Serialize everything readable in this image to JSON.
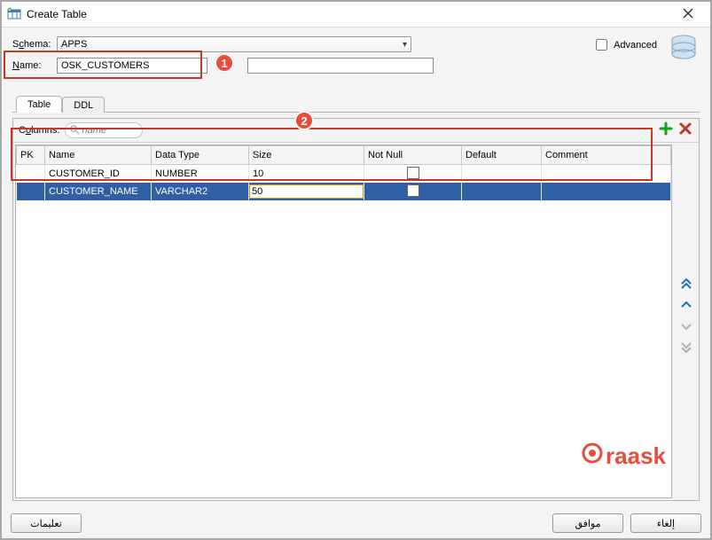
{
  "window": {
    "title": "Create Table"
  },
  "form": {
    "schema_label_pre": "S",
    "schema_label_u": "c",
    "schema_label_post": "hema:",
    "schema_value": "APPS",
    "name_label_pre": "",
    "name_label_u": "N",
    "name_label_post": "ame:",
    "name_value": "OSK_CUSTOMERS",
    "advanced_label": "Advanced"
  },
  "tabs": {
    "table": "Table",
    "ddl": "DDL"
  },
  "toolbar": {
    "columns_label_pre": "C",
    "columns_label_u": "o",
    "columns_label_post": "lumns:",
    "search_placeholder": "name"
  },
  "grid": {
    "headers": {
      "pk": "PK",
      "name": "Name",
      "data_type": "Data Type",
      "size": "Size",
      "not_null": "Not Null",
      "default": "Default",
      "comment": "Comment"
    },
    "rows": [
      {
        "pk": false,
        "name": "CUSTOMER_ID",
        "data_type": "NUMBER",
        "size": "10",
        "not_null": false,
        "default": "",
        "comment": "",
        "selected": false,
        "editing": false
      },
      {
        "pk": false,
        "name": "CUSTOMER_NAME",
        "data_type": "VARCHAR2",
        "size": "50",
        "not_null": false,
        "default": "",
        "comment": "",
        "selected": true,
        "editing": true
      }
    ]
  },
  "buttons": {
    "help": "تعليمات",
    "ok": "موافق",
    "cancel": "إلغاء"
  },
  "callouts": {
    "one": "1",
    "two": "2"
  },
  "watermark": "raask"
}
